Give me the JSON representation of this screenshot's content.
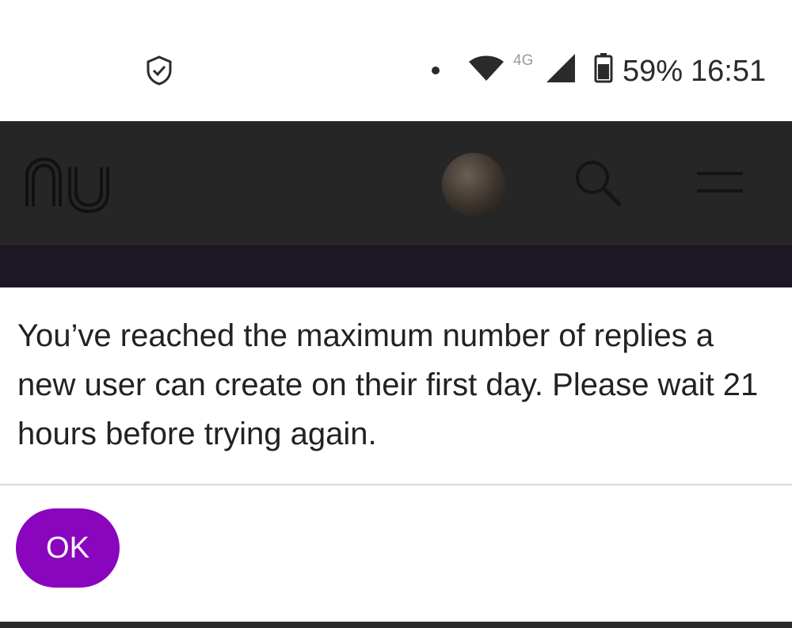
{
  "status_bar": {
    "shield_icon": "shield-check-icon",
    "network_type": "4G",
    "battery_percent": "59%",
    "time": "16:51"
  },
  "header": {
    "logo_icon": "nu-logo",
    "avatar_icon": "user-avatar",
    "search_icon": "search-icon",
    "menu_icon": "hamburger-menu-icon",
    "background_color": "#262626"
  },
  "modal": {
    "message": "You’ve reached the maximum number of replies a new user can create on their first day. Please wait 21 hours before trying again.",
    "ok_label": "OK",
    "accent_color": "#8a05be"
  }
}
